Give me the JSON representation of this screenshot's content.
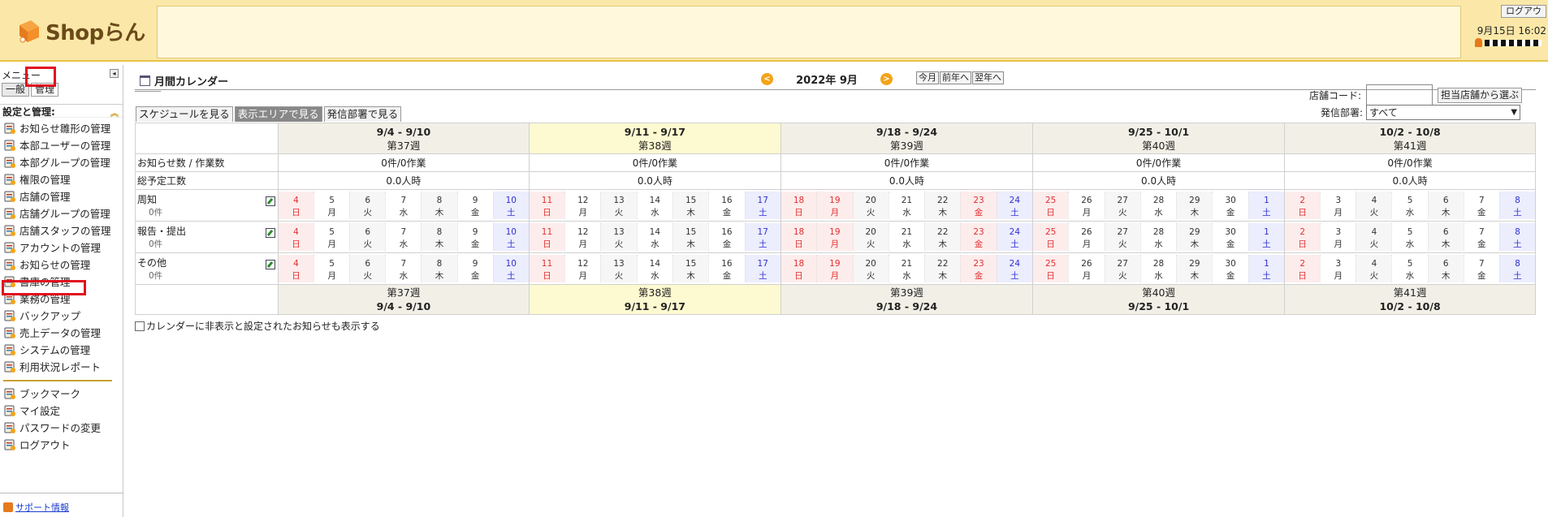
{
  "header": {
    "brand": "Shopらん",
    "logout": "ログアウ",
    "datetime": "9月15日 16:02"
  },
  "sidebar": {
    "menu_title": "メニュー",
    "tabs": [
      "一般",
      "管理"
    ],
    "section": "設定と管理:",
    "items": [
      {
        "label": "お知らせ雛形の管理",
        "icon": "template-icon"
      },
      {
        "label": "本部ユーザーの管理",
        "icon": "user-icon"
      },
      {
        "label": "本部グループの管理",
        "icon": "group-icon"
      },
      {
        "label": "権限の管理",
        "icon": "permission-icon"
      },
      {
        "label": "店舗の管理",
        "icon": "store-icon"
      },
      {
        "label": "店舗グループの管理",
        "icon": "store-group-icon"
      },
      {
        "label": "店舗スタッフの管理",
        "icon": "staff-icon"
      },
      {
        "label": "アカウントの管理",
        "icon": "account-icon"
      },
      {
        "label": "お知らせの管理",
        "icon": "notice-icon"
      },
      {
        "label": "書庫の管理",
        "icon": "archive-icon"
      },
      {
        "label": "業務の管理",
        "icon": "task-icon"
      },
      {
        "label": "バックアップ",
        "icon": "backup-icon"
      },
      {
        "label": "売上データの管理",
        "icon": "sales-icon"
      },
      {
        "label": "システムの管理",
        "icon": "system-icon"
      },
      {
        "label": "利用状況レポート",
        "icon": "report-icon"
      }
    ],
    "items2": [
      {
        "label": "ブックマーク",
        "icon": "bookmark-icon"
      },
      {
        "label": "マイ設定",
        "icon": "settings-icon"
      },
      {
        "label": "パスワードの変更",
        "icon": "lock-icon"
      },
      {
        "label": "ログアウト",
        "icon": "logout-icon"
      }
    ],
    "support": "サポート情報"
  },
  "main": {
    "title": "月間カレンダー",
    "month": "2022年 9月",
    "nav_buttons": [
      "今月",
      "前年へ",
      "翌年へ"
    ],
    "store_code_label": "店舗コード:",
    "store_select_button": "担当店舗から選ぶ",
    "dept_label": "発信部署:",
    "dept_value": "すべて",
    "view_tabs": [
      "スケジュールを見る",
      "表示エリアで見る",
      "発信部署で見る"
    ],
    "row_labels": {
      "count": "お知らせ数 / 作業数",
      "hours": "総予定工数"
    },
    "weeks": [
      {
        "range": "9/4 - 9/10",
        "week": "第37週",
        "count": "0件/0作業",
        "hours": "0.0人時"
      },
      {
        "range": "9/11 - 9/17",
        "week": "第38週",
        "count": "0件/0作業",
        "hours": "0.0人時"
      },
      {
        "range": "9/18 - 9/24",
        "week": "第39週",
        "count": "0件/0作業",
        "hours": "0.0人時"
      },
      {
        "range": "9/25 - 10/1",
        "week": "第40週",
        "count": "0件/0作業",
        "hours": "0.0人時"
      },
      {
        "range": "10/2 - 10/8",
        "week": "第41週",
        "count": "0件/0作業",
        "hours": "0.0人時"
      }
    ],
    "categories": [
      {
        "name": "周知",
        "count": "0件"
      },
      {
        "name": "報告・提出",
        "count": "0件"
      },
      {
        "name": "その他",
        "count": "0件"
      }
    ],
    "show_hidden_label": "カレンダーに非表示と設定されたお知らせも表示する"
  },
  "days": [
    [
      "4",
      "日",
      "sun"
    ],
    [
      "5",
      "月",
      ""
    ],
    [
      "6",
      "火",
      ""
    ],
    [
      "7",
      "水",
      ""
    ],
    [
      "8",
      "木",
      ""
    ],
    [
      "9",
      "金",
      ""
    ],
    [
      "10",
      "土",
      "sat"
    ],
    [
      "11",
      "日",
      "sun"
    ],
    [
      "12",
      "月",
      ""
    ],
    [
      "13",
      "火",
      ""
    ],
    [
      "14",
      "水",
      ""
    ],
    [
      "15",
      "木",
      ""
    ],
    [
      "16",
      "金",
      ""
    ],
    [
      "17",
      "土",
      "sat"
    ],
    [
      "18",
      "日",
      "sun"
    ],
    [
      "19",
      "月",
      "hol"
    ],
    [
      "20",
      "火",
      ""
    ],
    [
      "21",
      "水",
      ""
    ],
    [
      "22",
      "木",
      ""
    ],
    [
      "23",
      "金",
      "hol"
    ],
    [
      "24",
      "土",
      "sat"
    ],
    [
      "25",
      "日",
      "sun"
    ],
    [
      "26",
      "月",
      ""
    ],
    [
      "27",
      "火",
      ""
    ],
    [
      "28",
      "水",
      ""
    ],
    [
      "29",
      "木",
      ""
    ],
    [
      "30",
      "金",
      ""
    ],
    [
      "1",
      "土",
      "sat"
    ],
    [
      "2",
      "日",
      "sun"
    ],
    [
      "3",
      "月",
      ""
    ],
    [
      "4",
      "火",
      ""
    ],
    [
      "5",
      "水",
      ""
    ],
    [
      "6",
      "木",
      ""
    ],
    [
      "7",
      "金",
      ""
    ],
    [
      "8",
      "土",
      "sat"
    ]
  ],
  "colors": {
    "header_bg": "#fbe8a8",
    "accent": "#f4a418",
    "highlight": "#e0101e"
  }
}
